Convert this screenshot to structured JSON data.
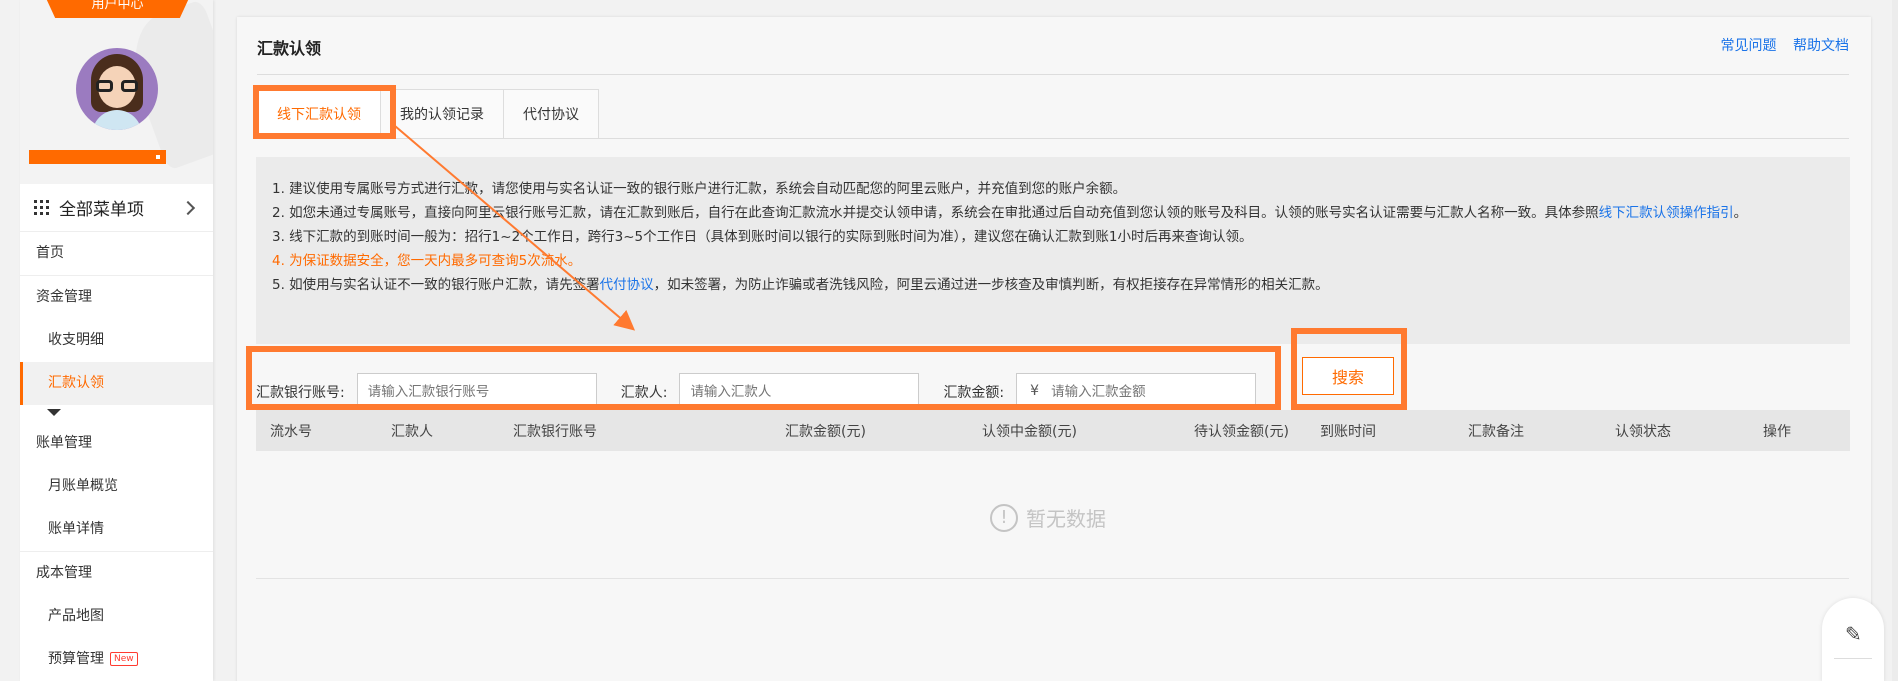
{
  "sidebar": {
    "user_center": "用户中心",
    "all_menu": "全部菜单项",
    "items": [
      {
        "type": "group",
        "label": "首页"
      },
      {
        "type": "group",
        "label": "资金管理"
      },
      {
        "type": "item",
        "label": "收支明细"
      },
      {
        "type": "item",
        "label": "汇款认领",
        "active": true
      },
      {
        "type": "group",
        "label": "账单管理"
      },
      {
        "type": "item",
        "label": "月账单概览"
      },
      {
        "type": "item",
        "label": "账单详情"
      },
      {
        "type": "group",
        "label": "成本管理"
      },
      {
        "type": "item",
        "label": "产品地图"
      },
      {
        "type": "item",
        "label": "预算管理",
        "badge": "New"
      }
    ]
  },
  "page": {
    "title": "汇款认领",
    "links": [
      "常见问题",
      "帮助文档"
    ]
  },
  "tabs": [
    {
      "label": "线下汇款认领",
      "active": true
    },
    {
      "label": "我的认领记录"
    },
    {
      "label": "代付协议"
    }
  ],
  "notice": {
    "line1": "1. 建议使用专属账号方式进行汇款，请您使用与实名认证一致的银行账户进行汇款，系统会自动匹配您的阿里云账户，并充值到您的账户余额。",
    "line2_a": "2. 如您未通过专属账号，直接向阿里云银行账号汇款，请在汇款到账后，自行在此查询汇款流水并提交认领申请，系统会在审批通过后自动充值到您认领的账号及科目。认领的账号实名认证需要与汇款人名称一致。具体参照",
    "line2_link": "线下汇款认领操作指引",
    "line2_b": "。",
    "line3": "3. 线下汇款的到账时间一般为：招行1~2个工作日，跨行3~5个工作日（具体到账时间以银行的实际到账时间为准），建议您在确认汇款到账1小时后再来查询认领。",
    "line4": "4. 为保证数据安全，您一天内最多可查询5次流水。",
    "line5_a": "5. 如使用与实名认证不一致的银行账户汇款，请先签署",
    "line5_link": "代付协议",
    "line5_b": "，如未签署，为防止诈骗或者洗钱风险，阿里云通过进一步核查及审慎判断，有权拒接存在异常情形的相关汇款。"
  },
  "search": {
    "account_label": "汇款银行账号:",
    "account_placeholder": "请输入汇款银行账号",
    "payer_label": "汇款人:",
    "payer_placeholder": "请输入汇款人",
    "amount_label": "汇款金额:",
    "amount_prefix": "¥",
    "amount_placeholder": "请输入汇款金额",
    "button": "搜索"
  },
  "table": {
    "columns": [
      "流水号",
      "汇款人",
      "汇款银行账号",
      "汇款金额(元)",
      "认领中金额(元)",
      "待认领金额(元)",
      "到账时间",
      "汇款备注",
      "认领状态",
      "操作"
    ],
    "empty_text": "暂无数据"
  },
  "colors": {
    "accent": "#ff6a00",
    "annotation": "#ff7a30",
    "link": "#1a73e8"
  }
}
